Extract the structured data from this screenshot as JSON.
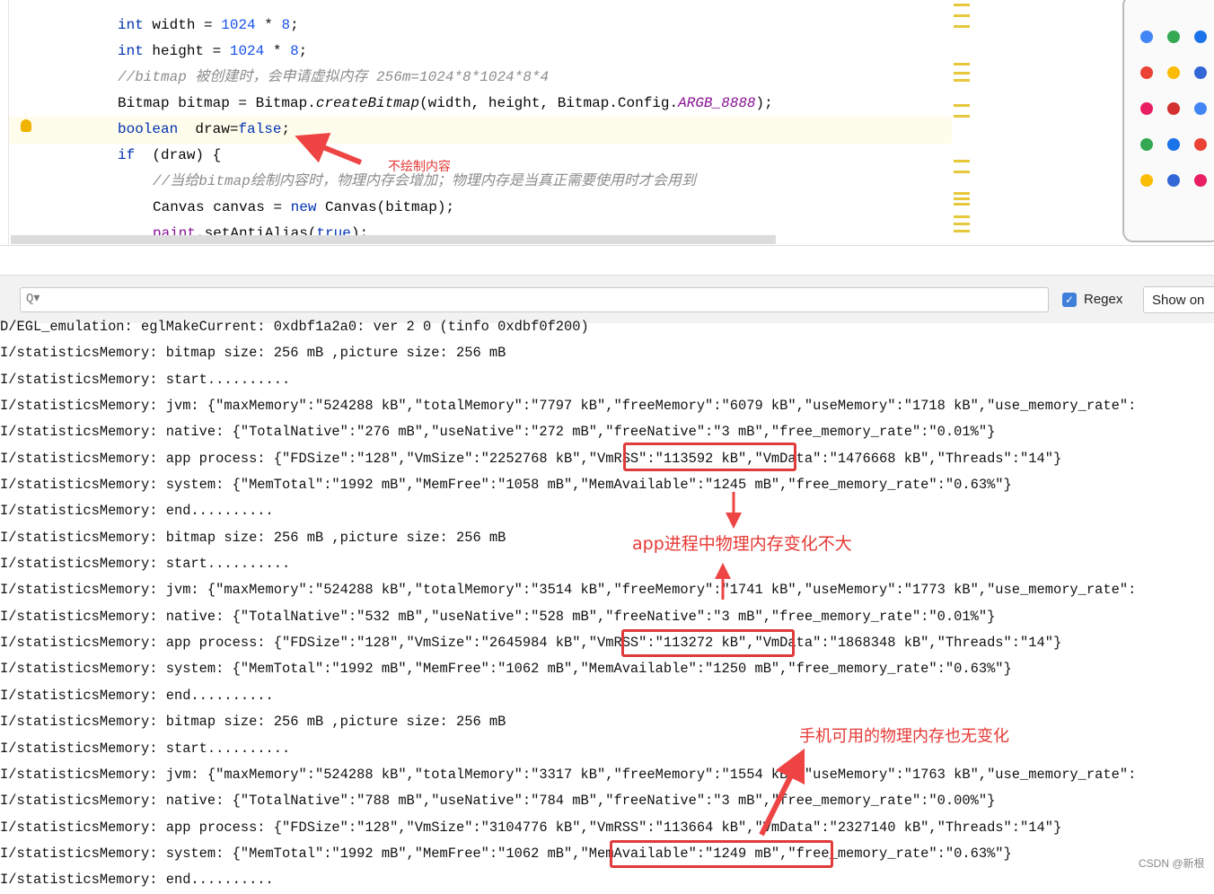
{
  "editor": {
    "lines": [
      {
        "parts": [
          [
            "kw",
            "int"
          ],
          [
            "",
            "width = "
          ],
          [
            "num",
            "1024"
          ],
          [
            "",
            " * "
          ],
          [
            "num",
            "8"
          ],
          [
            "",
            ";"
          ]
        ]
      },
      {
        "parts": [
          [
            "kw",
            "int"
          ],
          [
            "",
            "height = "
          ],
          [
            "num",
            "1024"
          ],
          [
            "",
            " * "
          ],
          [
            "num",
            "8"
          ],
          [
            "",
            ";"
          ]
        ]
      },
      {
        "parts": [
          [
            "cm",
            "//bitmap 被创建时，会申请虚拟内存 256m=1024*8*1024*8*4"
          ]
        ]
      },
      {
        "parts": [
          [
            "",
            "Bitmap bitmap = Bitmap."
          ],
          [
            "it",
            "createBitmap"
          ],
          [
            "",
            "(width, height, Bitmap.Config."
          ],
          [
            "cst",
            "ARGB_8888"
          ],
          [
            "",
            ");"
          ]
        ]
      },
      {
        "parts": [
          [
            "kw",
            "boolean"
          ],
          [
            "",
            " draw="
          ],
          [
            "kw",
            "false"
          ],
          [
            "",
            ";"
          ]
        ]
      },
      {
        "parts": [
          [
            "kw",
            "if"
          ],
          [
            "",
            " (draw) {"
          ]
        ]
      },
      {
        "indent": true,
        "parts": [
          [
            "cm",
            "//当给bitmap绘制内容时，物理内存会增加；物理内存是当真正需要使用时才会用到"
          ]
        ]
      },
      {
        "indent": true,
        "parts": [
          [
            "",
            "Canvas canvas = "
          ],
          [
            "kw",
            "new"
          ],
          [
            "",
            " Canvas(bitmap);"
          ]
        ]
      },
      {
        "indent": true,
        "parts": [
          [
            "fld",
            "paint"
          ],
          [
            "",
            ".setAntiAlias("
          ],
          [
            "kw",
            "true"
          ],
          [
            "",
            ");"
          ]
        ]
      }
    ]
  },
  "search": {
    "placeholder": "Q▾",
    "regex_label": "Regex",
    "regex_checked": true,
    "show_on_label": "Show on"
  },
  "log": [
    "D/EGL_emulation: eglMakeCurrent: 0xdbf1a2a0: ver 2 0 (tinfo 0xdbf0f200)",
    "I/statisticsMemory: bitmap size: 256 mB ,picture size: 256 mB",
    "I/statisticsMemory: start..........",
    "I/statisticsMemory: jvm: {\"maxMemory\":\"524288 kB\",\"totalMemory\":\"7797 kB\",\"freeMemory\":\"6079 kB\",\"useMemory\":\"1718 kB\",\"use_memory_rate\":",
    "I/statisticsMemory: native: {\"TotalNative\":\"276 mB\",\"useNative\":\"272 mB\",\"freeNative\":\"3 mB\",\"free_memory_rate\":\"0.01%\"}",
    "I/statisticsMemory: app process: {\"FDSize\":\"128\",\"VmSize\":\"2252768 kB\",\"VmRSS\":\"113592 kB\",\"VmData\":\"1476668 kB\",\"Threads\":\"14\"}",
    "I/statisticsMemory: system: {\"MemTotal\":\"1992 mB\",\"MemFree\":\"1058 mB\",\"MemAvailable\":\"1245 mB\",\"free_memory_rate\":\"0.63%\"}",
    "I/statisticsMemory: end..........",
    "I/statisticsMemory: bitmap size: 256 mB ,picture size: 256 mB",
    "I/statisticsMemory: start..........",
    "I/statisticsMemory: jvm: {\"maxMemory\":\"524288 kB\",\"totalMemory\":\"3514 kB\",\"freeMemory\":\"1741 kB\",\"useMemory\":\"1773 kB\",\"use_memory_rate\":",
    "I/statisticsMemory: native: {\"TotalNative\":\"532 mB\",\"useNative\":\"528 mB\",\"freeNative\":\"3 mB\",\"free_memory_rate\":\"0.01%\"}",
    "I/statisticsMemory: app process: {\"FDSize\":\"128\",\"VmSize\":\"2645984 kB\",\"VmRSS\":\"113272 kB\",\"VmData\":\"1868348 kB\",\"Threads\":\"14\"}",
    "I/statisticsMemory: system: {\"MemTotal\":\"1992 mB\",\"MemFree\":\"1062 mB\",\"MemAvailable\":\"1250 mB\",\"free_memory_rate\":\"0.63%\"}",
    "I/statisticsMemory: end..........",
    "I/statisticsMemory: bitmap size: 256 mB ,picture size: 256 mB",
    "I/statisticsMemory: start..........",
    "I/statisticsMemory: jvm: {\"maxMemory\":\"524288 kB\",\"totalMemory\":\"3317 kB\",\"freeMemory\":\"1554 kB\",\"useMemory\":\"1763 kB\",\"use_memory_rate\":",
    "I/statisticsMemory: native: {\"TotalNative\":\"788 mB\",\"useNative\":\"784 mB\",\"freeNative\":\"3 mB\",\"free_memory_rate\":\"0.00%\"}",
    "I/statisticsMemory: app process: {\"FDSize\":\"128\",\"VmSize\":\"3104776 kB\",\"VmRSS\":\"113664 kB\",\"VmData\":\"2327140 kB\",\"Threads\":\"14\"}",
    "I/statisticsMemory: system: {\"MemTotal\":\"1992 mB\",\"MemFree\":\"1062 mB\",\"MemAvailable\":\"1249 mB\",\"free_memory_rate\":\"0.63%\"}",
    "I/statisticsMemory: end.........."
  ],
  "annotations": {
    "no_draw": "不绘制内容",
    "rss_note": "app进程中物理内存变化不大",
    "avail_note": "手机可用的物理内存也无变化",
    "color": "#e53935"
  },
  "watermark": "CSDN @新根"
}
